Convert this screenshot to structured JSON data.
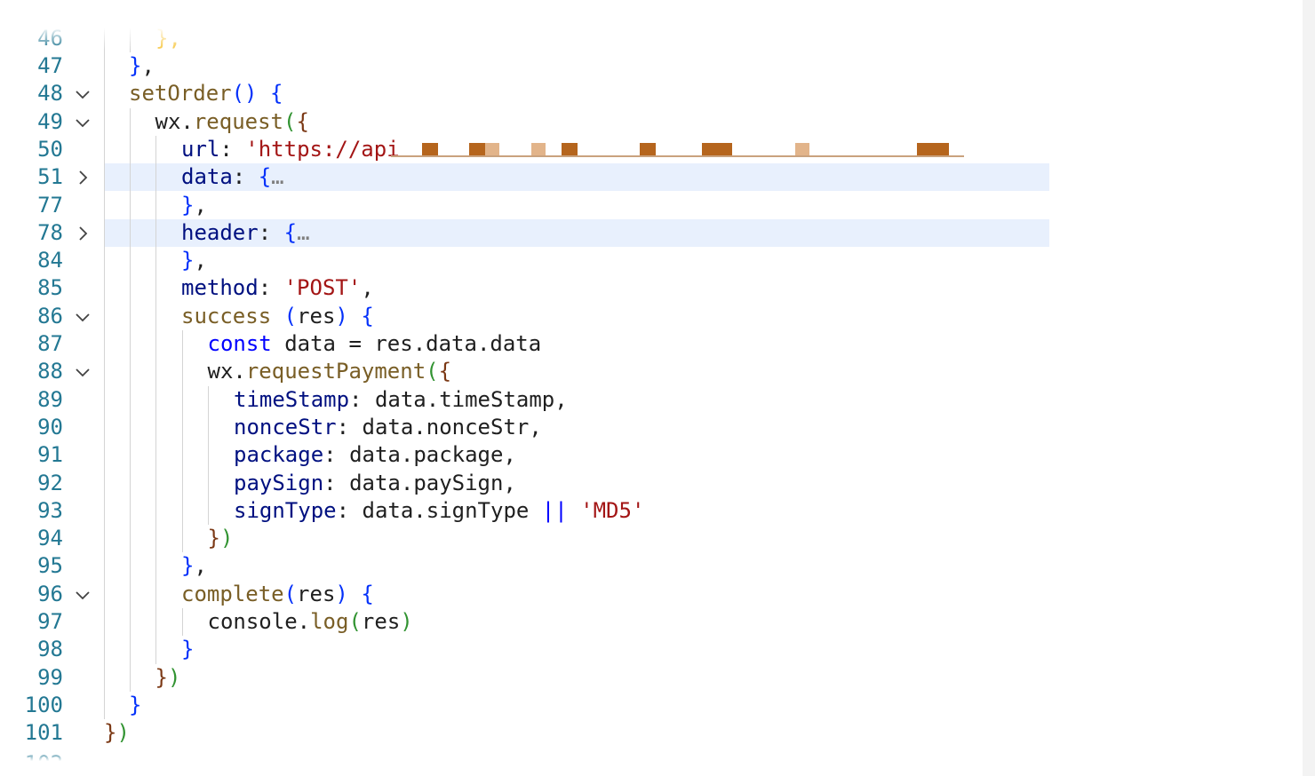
{
  "editor": {
    "partial_top_line": {
      "number": "46",
      "text": "},",
      "color": "#f7c948"
    },
    "partial_bottom_line": {
      "number": "102"
    },
    "lines": [
      {
        "number": "47",
        "indent": 1,
        "fold": null,
        "tokens": [
          {
            "t": "}",
            "c": "p1"
          },
          {
            "t": ",",
            "c": "sym"
          }
        ]
      },
      {
        "number": "48",
        "indent": 1,
        "fold": "expanded",
        "tokens": [
          {
            "t": "setOrder",
            "c": "fn"
          },
          {
            "t": "()",
            "c": "p1"
          },
          {
            "t": " ",
            "c": "sym"
          },
          {
            "t": "{",
            "c": "p1"
          }
        ]
      },
      {
        "number": "49",
        "indent": 2,
        "fold": "expanded",
        "tokens": [
          {
            "t": "wx",
            "c": "def"
          },
          {
            "t": ".",
            "c": "sym"
          },
          {
            "t": "request",
            "c": "fn"
          },
          {
            "t": "(",
            "c": "p2"
          },
          {
            "t": "{",
            "c": "p3"
          }
        ]
      },
      {
        "number": "50",
        "indent": 3,
        "fold": null,
        "tokens": [
          {
            "t": "url",
            "c": "prop"
          },
          {
            "t": ": ",
            "c": "sym"
          },
          {
            "t": "'https://api",
            "c": "str"
          }
        ],
        "redacted": true
      },
      {
        "number": "51",
        "indent": 3,
        "fold": "collapsed",
        "highlight": true,
        "tokens": [
          {
            "t": "data",
            "c": "prop"
          },
          {
            "t": ": ",
            "c": "sym"
          },
          {
            "t": "{",
            "c": "p1"
          },
          {
            "t": "…",
            "c": "ell"
          }
        ]
      },
      {
        "number": "77",
        "indent": 3,
        "fold": null,
        "tokens": [
          {
            "t": "}",
            "c": "p1"
          },
          {
            "t": ",",
            "c": "sym"
          }
        ]
      },
      {
        "number": "78",
        "indent": 3,
        "fold": "collapsed",
        "highlight": true,
        "tokens": [
          {
            "t": "header",
            "c": "prop"
          },
          {
            "t": ": ",
            "c": "sym"
          },
          {
            "t": "{",
            "c": "p1"
          },
          {
            "t": "…",
            "c": "ell"
          }
        ]
      },
      {
        "number": "84",
        "indent": 3,
        "fold": null,
        "tokens": [
          {
            "t": "}",
            "c": "p1"
          },
          {
            "t": ",",
            "c": "sym"
          }
        ]
      },
      {
        "number": "85",
        "indent": 3,
        "fold": null,
        "tokens": [
          {
            "t": "method",
            "c": "prop"
          },
          {
            "t": ": ",
            "c": "sym"
          },
          {
            "t": "'POST'",
            "c": "str"
          },
          {
            "t": ",",
            "c": "sym"
          }
        ]
      },
      {
        "number": "86",
        "indent": 3,
        "fold": "expanded",
        "tokens": [
          {
            "t": "success",
            "c": "fn"
          },
          {
            "t": " ",
            "c": "sym"
          },
          {
            "t": "(",
            "c": "p1"
          },
          {
            "t": "res",
            "c": "def"
          },
          {
            "t": ")",
            "c": "p1"
          },
          {
            "t": " ",
            "c": "sym"
          },
          {
            "t": "{",
            "c": "p1"
          }
        ]
      },
      {
        "number": "87",
        "indent": 4,
        "fold": null,
        "tokens": [
          {
            "t": "const",
            "c": "kw"
          },
          {
            "t": " data ",
            "c": "def"
          },
          {
            "t": "=",
            "c": "sym"
          },
          {
            "t": " res",
            "c": "def"
          },
          {
            "t": ".",
            "c": "sym"
          },
          {
            "t": "data",
            "c": "def"
          },
          {
            "t": ".",
            "c": "sym"
          },
          {
            "t": "data",
            "c": "def"
          }
        ]
      },
      {
        "number": "88",
        "indent": 4,
        "fold": "expanded",
        "tokens": [
          {
            "t": "wx",
            "c": "def"
          },
          {
            "t": ".",
            "c": "sym"
          },
          {
            "t": "requestPayment",
            "c": "fn"
          },
          {
            "t": "(",
            "c": "p2"
          },
          {
            "t": "{",
            "c": "p3"
          }
        ]
      },
      {
        "number": "89",
        "indent": 5,
        "fold": null,
        "tokens": [
          {
            "t": "timeStamp",
            "c": "prop"
          },
          {
            "t": ": ",
            "c": "sym"
          },
          {
            "t": "data",
            "c": "def"
          },
          {
            "t": ".",
            "c": "sym"
          },
          {
            "t": "timeStamp",
            "c": "def"
          },
          {
            "t": ",",
            "c": "sym"
          }
        ]
      },
      {
        "number": "90",
        "indent": 5,
        "fold": null,
        "tokens": [
          {
            "t": "nonceStr",
            "c": "prop"
          },
          {
            "t": ": ",
            "c": "sym"
          },
          {
            "t": "data",
            "c": "def"
          },
          {
            "t": ".",
            "c": "sym"
          },
          {
            "t": "nonceStr",
            "c": "def"
          },
          {
            "t": ",",
            "c": "sym"
          }
        ]
      },
      {
        "number": "91",
        "indent": 5,
        "fold": null,
        "tokens": [
          {
            "t": "package",
            "c": "prop"
          },
          {
            "t": ": ",
            "c": "sym"
          },
          {
            "t": "data",
            "c": "def"
          },
          {
            "t": ".",
            "c": "sym"
          },
          {
            "t": "package",
            "c": "def"
          },
          {
            "t": ",",
            "c": "sym"
          }
        ]
      },
      {
        "number": "92",
        "indent": 5,
        "fold": null,
        "tokens": [
          {
            "t": "paySign",
            "c": "prop"
          },
          {
            "t": ": ",
            "c": "sym"
          },
          {
            "t": "data",
            "c": "def"
          },
          {
            "t": ".",
            "c": "sym"
          },
          {
            "t": "paySign",
            "c": "def"
          },
          {
            "t": ",",
            "c": "sym"
          }
        ]
      },
      {
        "number": "93",
        "indent": 5,
        "fold": null,
        "tokens": [
          {
            "t": "signType",
            "c": "prop"
          },
          {
            "t": ": ",
            "c": "sym"
          },
          {
            "t": "data",
            "c": "def"
          },
          {
            "t": ".",
            "c": "sym"
          },
          {
            "t": "signType",
            "c": "def"
          },
          {
            "t": " ",
            "c": "sym"
          },
          {
            "t": "||",
            "c": "kw"
          },
          {
            "t": " ",
            "c": "sym"
          },
          {
            "t": "'MD5'",
            "c": "str"
          }
        ]
      },
      {
        "number": "94",
        "indent": 4,
        "fold": null,
        "tokens": [
          {
            "t": "}",
            "c": "p3"
          },
          {
            "t": ")",
            "c": "p2"
          }
        ]
      },
      {
        "number": "95",
        "indent": 3,
        "fold": null,
        "tokens": [
          {
            "t": "}",
            "c": "p1"
          },
          {
            "t": ",",
            "c": "sym"
          }
        ]
      },
      {
        "number": "96",
        "indent": 3,
        "fold": "expanded",
        "tokens": [
          {
            "t": "complete",
            "c": "fn"
          },
          {
            "t": "(",
            "c": "p1"
          },
          {
            "t": "res",
            "c": "def"
          },
          {
            "t": ")",
            "c": "p1"
          },
          {
            "t": " ",
            "c": "sym"
          },
          {
            "t": "{",
            "c": "p1"
          }
        ]
      },
      {
        "number": "97",
        "indent": 4,
        "fold": null,
        "tokens": [
          {
            "t": "console",
            "c": "def"
          },
          {
            "t": ".",
            "c": "sym"
          },
          {
            "t": "log",
            "c": "fn"
          },
          {
            "t": "(",
            "c": "p2"
          },
          {
            "t": "res",
            "c": "def"
          },
          {
            "t": ")",
            "c": "p2"
          }
        ]
      },
      {
        "number": "98",
        "indent": 3,
        "fold": null,
        "tokens": [
          {
            "t": "}",
            "c": "p1"
          }
        ]
      },
      {
        "number": "99",
        "indent": 2,
        "fold": null,
        "tokens": [
          {
            "t": "}",
            "c": "p3"
          },
          {
            "t": ")",
            "c": "p2"
          }
        ]
      },
      {
        "number": "100",
        "indent": 1,
        "fold": null,
        "tokens": [
          {
            "t": "}",
            "c": "p1"
          }
        ]
      },
      {
        "number": "101",
        "indent": 0,
        "fold": null,
        "tokens": [
          {
            "t": "}",
            "c": "p3"
          },
          {
            "t": ")",
            "c": "p2"
          }
        ]
      }
    ],
    "colors": {
      "line_number": "#237893",
      "highlight_bg": "#e8f0fd",
      "property": "#001080",
      "function": "#795e26",
      "string": "#a31515",
      "keyword": "#0000ff",
      "redaction": "#b5651d"
    }
  }
}
